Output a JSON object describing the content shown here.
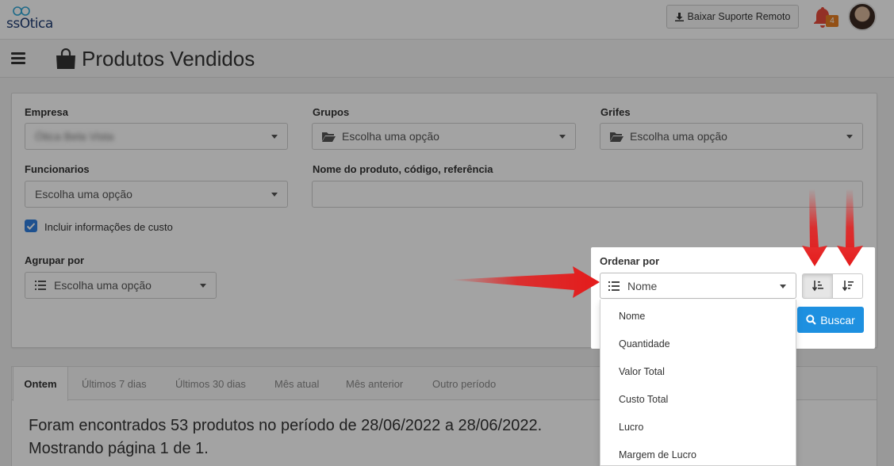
{
  "header": {
    "logo_text": "ssOtica",
    "support_button_label": "Baixar Suporte Remoto",
    "notification_count": "4"
  },
  "page": {
    "title": "Produtos Vendidos"
  },
  "filters": {
    "empresa": {
      "label": "Empresa",
      "value": "Ótica Bela Vista"
    },
    "grupos": {
      "label": "Grupos",
      "placeholder": "Escolha uma opção"
    },
    "grifes": {
      "label": "Grifes",
      "placeholder": "Escolha uma opção"
    },
    "funcionarios": {
      "label": "Funcionarios",
      "placeholder": "Escolha uma opção"
    },
    "nome_produto": {
      "label": "Nome do produto, código, referência",
      "value": ""
    },
    "incluir_custo": {
      "label": "Incluir informações de custo",
      "checked": true
    },
    "agrupar": {
      "label": "Agrupar por",
      "placeholder": "Escolha uma opção"
    },
    "ordenar": {
      "label": "Ordenar por",
      "value": "Nome",
      "options": [
        "Nome",
        "Quantidade",
        "Valor Total",
        "Custo Total",
        "Lucro",
        "Margem de Lucro"
      ]
    },
    "buscar_label": "Buscar"
  },
  "tabs": [
    {
      "label": "Ontem",
      "active": true
    },
    {
      "label": "Últimos 7 dias",
      "active": false
    },
    {
      "label": "Últimos 30 dias",
      "active": false
    },
    {
      "label": "Mês atual",
      "active": false
    },
    {
      "label": "Mês anterior",
      "active": false
    },
    {
      "label": "Outro período",
      "active": false
    }
  ],
  "results": {
    "summary": "Foram encontrados 53 produtos no período de 28/06/2022 a 28/06/2022.",
    "pagination": "Mostrando página 1 de 1."
  },
  "colors": {
    "primary": "#1e90e0",
    "annotation_arrow": "#e41b1b",
    "bell": "#e74c3c",
    "badge": "#e67e22"
  }
}
